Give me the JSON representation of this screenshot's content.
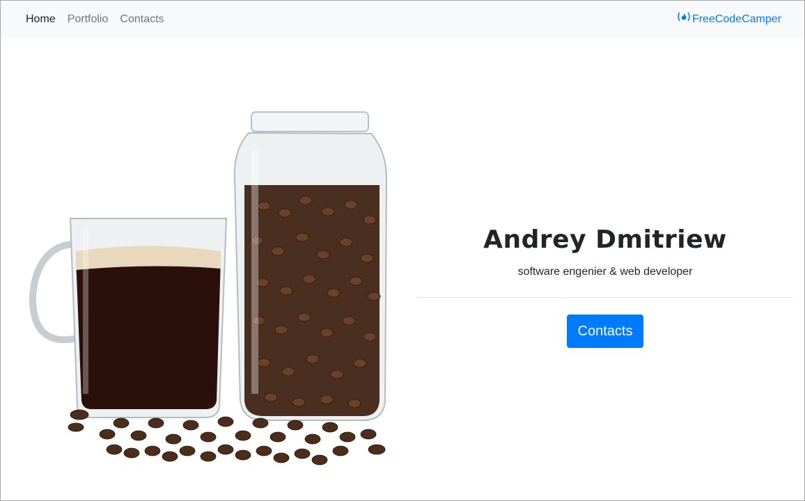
{
  "navbar": {
    "links": [
      {
        "label": "Home",
        "active": true
      },
      {
        "label": "Portfolio",
        "active": false
      },
      {
        "label": "Contacts",
        "active": false
      }
    ],
    "brand": {
      "icon": "fire-icon",
      "icon_glyph": "(🔥)",
      "label": "FreeCodeCamper"
    }
  },
  "hero": {
    "image": {
      "icon": "coffee-cup-and-bean-jar-image"
    },
    "name": "Andrey Dmitriew",
    "subtitle": "software engenier & web developer",
    "button_label": "Contacts"
  },
  "colors": {
    "accent": "#007bff",
    "navbar_bg": "#f8f9fa",
    "text": "#212529",
    "muted": "#6c757d",
    "coffee": "#2a0f0a",
    "beans": "#4a2e1f"
  }
}
